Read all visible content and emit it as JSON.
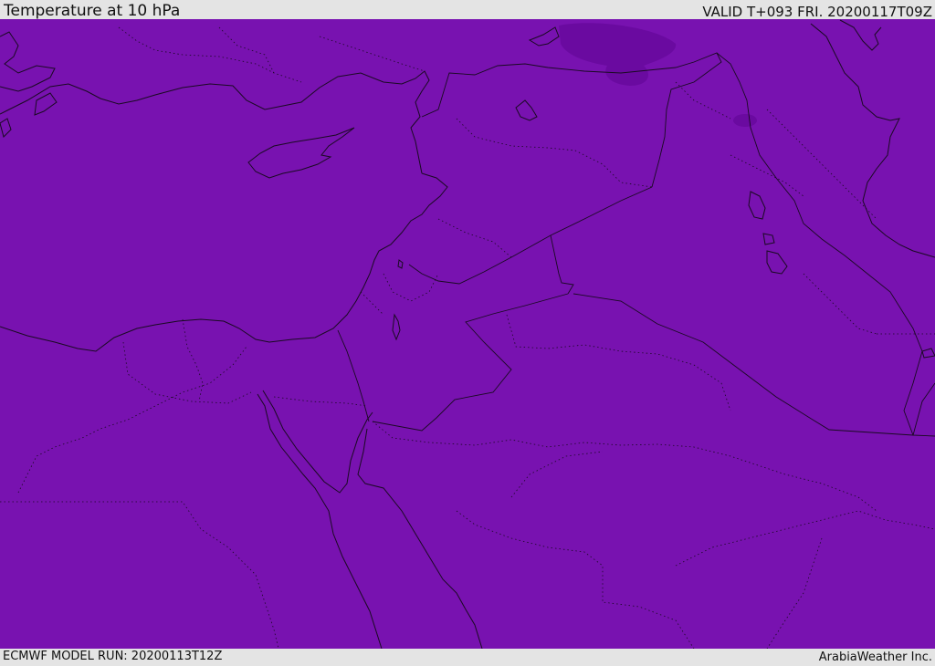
{
  "header": {
    "title": "Temperature at 10 hPa",
    "valid_time": "VALID T+093 FRI. 20200117T09Z"
  },
  "footer": {
    "model_run": "ECMWF MODEL RUN: 20200113T12Z",
    "credit": "ArabiaWeather Inc."
  },
  "map": {
    "variable": "temperature",
    "pressure_level_hpa": 10,
    "fill_color": "#7812b0",
    "cold_patch_color": "#6a0aa0",
    "coastline_color": "#1a0a22",
    "border_style": "dotted"
  }
}
